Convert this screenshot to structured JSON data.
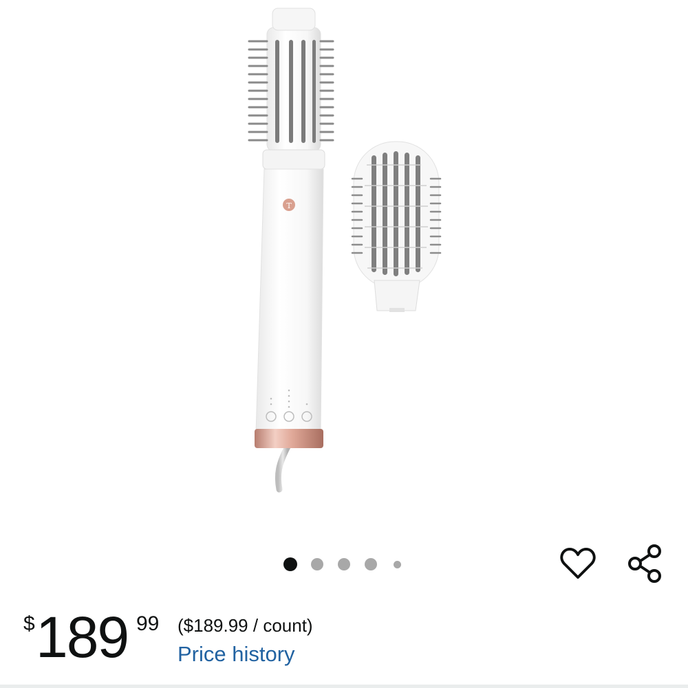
{
  "product": {
    "image_alt_icon": "hair-dryer-brush-image",
    "carousel": {
      "total": 5,
      "active_index": 0
    }
  },
  "actions": {
    "wishlist_icon": "heart-icon",
    "share_icon": "share-icon"
  },
  "price": {
    "symbol": "$",
    "whole": "189",
    "fraction": "99",
    "unit_price": "($189.99 / count)",
    "history_link": "Price history"
  },
  "colors": {
    "text": "#0f1111",
    "link": "#2162a1",
    "dot_active": "#0f1111",
    "dot_inactive": "#a8a8a8",
    "accent_rose_gold": "#d9a08f"
  }
}
